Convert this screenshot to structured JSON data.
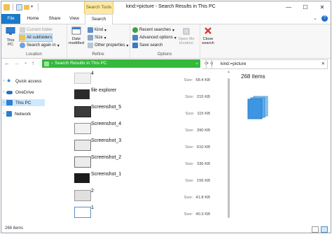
{
  "window": {
    "title": "kind:=picture - Search Results in This PC",
    "context_tab": "Search Tools",
    "minimize": "—",
    "maximize": "☐",
    "close": "✕"
  },
  "ribbon_tabs": {
    "file": "File",
    "home": "Home",
    "share": "Share",
    "view": "View",
    "search": "Search"
  },
  "ribbon": {
    "location": {
      "this_pc": "This PC",
      "current_folder": "Current folder",
      "all_subfolders": "All subfolders",
      "search_again": "Search again in",
      "label": "Location"
    },
    "refine": {
      "date_modified": "Date modified",
      "kind": "Kind",
      "size": "Size",
      "other_properties": "Other properties",
      "label": "Refine"
    },
    "options": {
      "recent_searches": "Recent searches",
      "advanced_options": "Advanced options",
      "save_search": "Save search",
      "open_file_location": "Open file location",
      "label": "Options"
    },
    "close_search": "Close search"
  },
  "address": {
    "path": "Search Results in This PC",
    "search_query": "kind:=picture"
  },
  "nav": [
    {
      "label": "Quick access",
      "icon": "star-icon",
      "color": "#1e73c8"
    },
    {
      "label": "OneDrive",
      "icon": "cloud-icon",
      "color": "#1e73c8"
    },
    {
      "label": "This PC",
      "icon": "monitor-icon",
      "color": "#2b7fd4"
    },
    {
      "label": "Network",
      "icon": "network-icon",
      "color": "#2b7fd4"
    }
  ],
  "files": [
    {
      "name": "4",
      "size": "58.4 KB"
    },
    {
      "name": "file explorer",
      "size": "215 KB"
    },
    {
      "name": "Screenshot_5",
      "size": "115 KB"
    },
    {
      "name": "Screenshot_4",
      "size": "390 KB"
    },
    {
      "name": "Screenshot_3",
      "size": "610 KB"
    },
    {
      "name": "Screenshot_2",
      "size": "336 KB"
    },
    {
      "name": "Screenshot_1",
      "size": "156 KB"
    },
    {
      "name": "2",
      "size": "41.8 KB"
    },
    {
      "name": "1",
      "size": "40.3 KB"
    }
  ],
  "size_label": "Size:",
  "preview": {
    "count": "268 items"
  },
  "status": {
    "count": "268 items"
  },
  "colors": {
    "accent": "#1979ca",
    "address_bar": "#35b83c",
    "context_tab": "#fde9a5"
  }
}
